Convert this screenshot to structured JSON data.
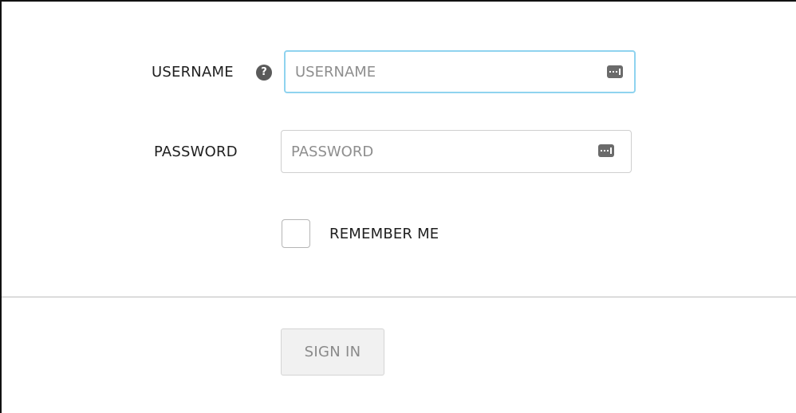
{
  "form": {
    "username": {
      "label": "USERNAME",
      "help_icon": "?",
      "placeholder": "USERNAME",
      "value": "",
      "focused": true
    },
    "password": {
      "label": "PASSWORD",
      "placeholder": "PASSWORD",
      "value": ""
    },
    "remember_me": {
      "label": "REMEMBER ME",
      "checked": false
    },
    "sign_in": {
      "label": "SIGN IN",
      "enabled": false
    }
  },
  "icons": {
    "help": "question-circle-icon",
    "username_field": "password-manager-key-icon",
    "password_field": "password-manager-key-icon"
  },
  "colors": {
    "focus_border": "#8fd3ef",
    "button_bg": "#f1f1f1",
    "button_text": "#8a8a8a"
  }
}
